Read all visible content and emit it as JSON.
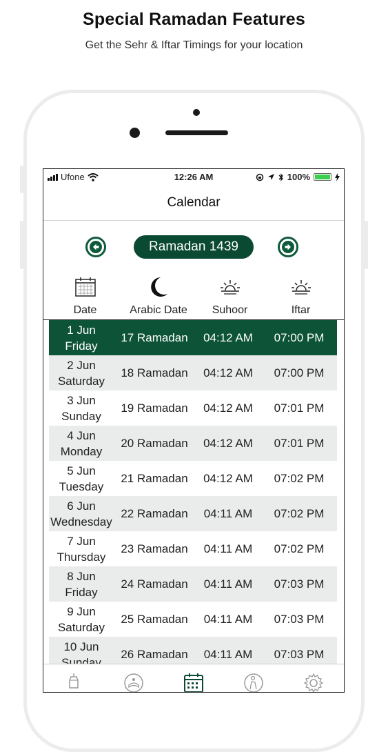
{
  "promo": {
    "title": "Special Ramadan Features",
    "subtitle": "Get the Sehr & Iftar Timings for your location"
  },
  "status_bar": {
    "carrier": "Ufone",
    "time": "12:26 AM",
    "battery": "100%"
  },
  "nav": {
    "title": "Calendar"
  },
  "month_selector": {
    "label": "Ramadan 1439",
    "prev_icon": "arrow-left-icon",
    "next_icon": "arrow-right-icon"
  },
  "columns": {
    "date": "Date",
    "arabic": "Arabic Date",
    "suhoor": "Suhoor",
    "iftar": "Iftar"
  },
  "colors": {
    "accent": "#0b4a32",
    "selected_row": "#0c5338",
    "alt_row": "#e9eceb"
  },
  "rows": [
    {
      "day": "1 Jun",
      "weekday": "Friday",
      "arabic": "17 Ramadan",
      "suhoor": "04:12 AM",
      "iftar": "07:00 PM"
    },
    {
      "day": "2 Jun",
      "weekday": "Saturday",
      "arabic": "18 Ramadan",
      "suhoor": "04:12 AM",
      "iftar": "07:00 PM"
    },
    {
      "day": "3 Jun",
      "weekday": "Sunday",
      "arabic": "19 Ramadan",
      "suhoor": "04:12 AM",
      "iftar": "07:01 PM"
    },
    {
      "day": "4 Jun",
      "weekday": "Monday",
      "arabic": "20 Ramadan",
      "suhoor": "04:12 AM",
      "iftar": "07:01 PM"
    },
    {
      "day": "5 Jun",
      "weekday": "Tuesday",
      "arabic": "21 Ramadan",
      "suhoor": "04:12 AM",
      "iftar": "07:02 PM"
    },
    {
      "day": "6 Jun",
      "weekday": "Wednesday",
      "arabic": "22 Ramadan",
      "suhoor": "04:11 AM",
      "iftar": "07:02 PM"
    },
    {
      "day": "7 Jun",
      "weekday": "Thursday",
      "arabic": "23 Ramadan",
      "suhoor": "04:11 AM",
      "iftar": "07:02 PM"
    },
    {
      "day": "8 Jun",
      "weekday": "Friday",
      "arabic": "24 Ramadan",
      "suhoor": "04:11 AM",
      "iftar": "07:03 PM"
    },
    {
      "day": "9 Jun",
      "weekday": "Saturday",
      "arabic": "25 Ramadan",
      "suhoor": "04:11 AM",
      "iftar": "07:03 PM"
    },
    {
      "day": "10 Jun",
      "weekday": "Sunday",
      "arabic": "26 Ramadan",
      "suhoor": "04:11 AM",
      "iftar": "07:03 PM"
    }
  ],
  "tabs": [
    {
      "icon": "lantern-icon"
    },
    {
      "icon": "quran-icon"
    },
    {
      "icon": "calendar-icon",
      "active": true
    },
    {
      "icon": "prayer-icon"
    },
    {
      "icon": "settings-gear-icon"
    }
  ]
}
